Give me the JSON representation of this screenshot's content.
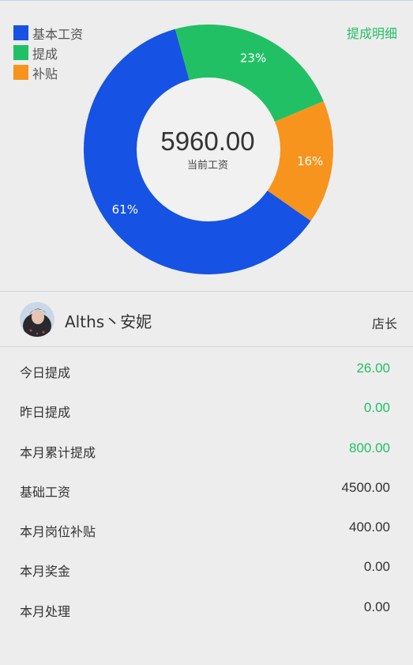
{
  "chart_data": {
    "type": "pie",
    "style": "donut",
    "slices": [
      {
        "label": "基本工资",
        "percent": 61,
        "percent_label": "61%",
        "color": "#1652e3"
      },
      {
        "label": "提成",
        "percent": 23,
        "percent_label": "23%",
        "color": "#22c064"
      },
      {
        "label": "补贴",
        "percent": 16,
        "percent_label": "16%",
        "color": "#f7941d"
      }
    ],
    "center_value": "5960.00",
    "center_label": "当前工资",
    "legend_position": "top-left"
  },
  "header": {
    "detail_link": "提成明细"
  },
  "user": {
    "name": "Alths丶安妮",
    "role": "店长"
  },
  "stats": [
    {
      "label": "今日提成",
      "value": "26.00",
      "highlight": true
    },
    {
      "label": "昨日提成",
      "value": "0.00",
      "highlight": true
    },
    {
      "label": "本月累计提成",
      "value": "800.00",
      "highlight": true
    },
    {
      "label": "基础工资",
      "value": "4500.00",
      "highlight": false
    },
    {
      "label": "本月岗位补贴",
      "value": "400.00",
      "highlight": false
    },
    {
      "label": "本月奖金",
      "value": "0.00",
      "highlight": false
    },
    {
      "label": "本月处理",
      "value": "0.00",
      "highlight": false
    }
  ],
  "colors": {
    "green": "#22c064",
    "blue": "#1652e3",
    "orange": "#f7941d",
    "background": "#ededee"
  }
}
